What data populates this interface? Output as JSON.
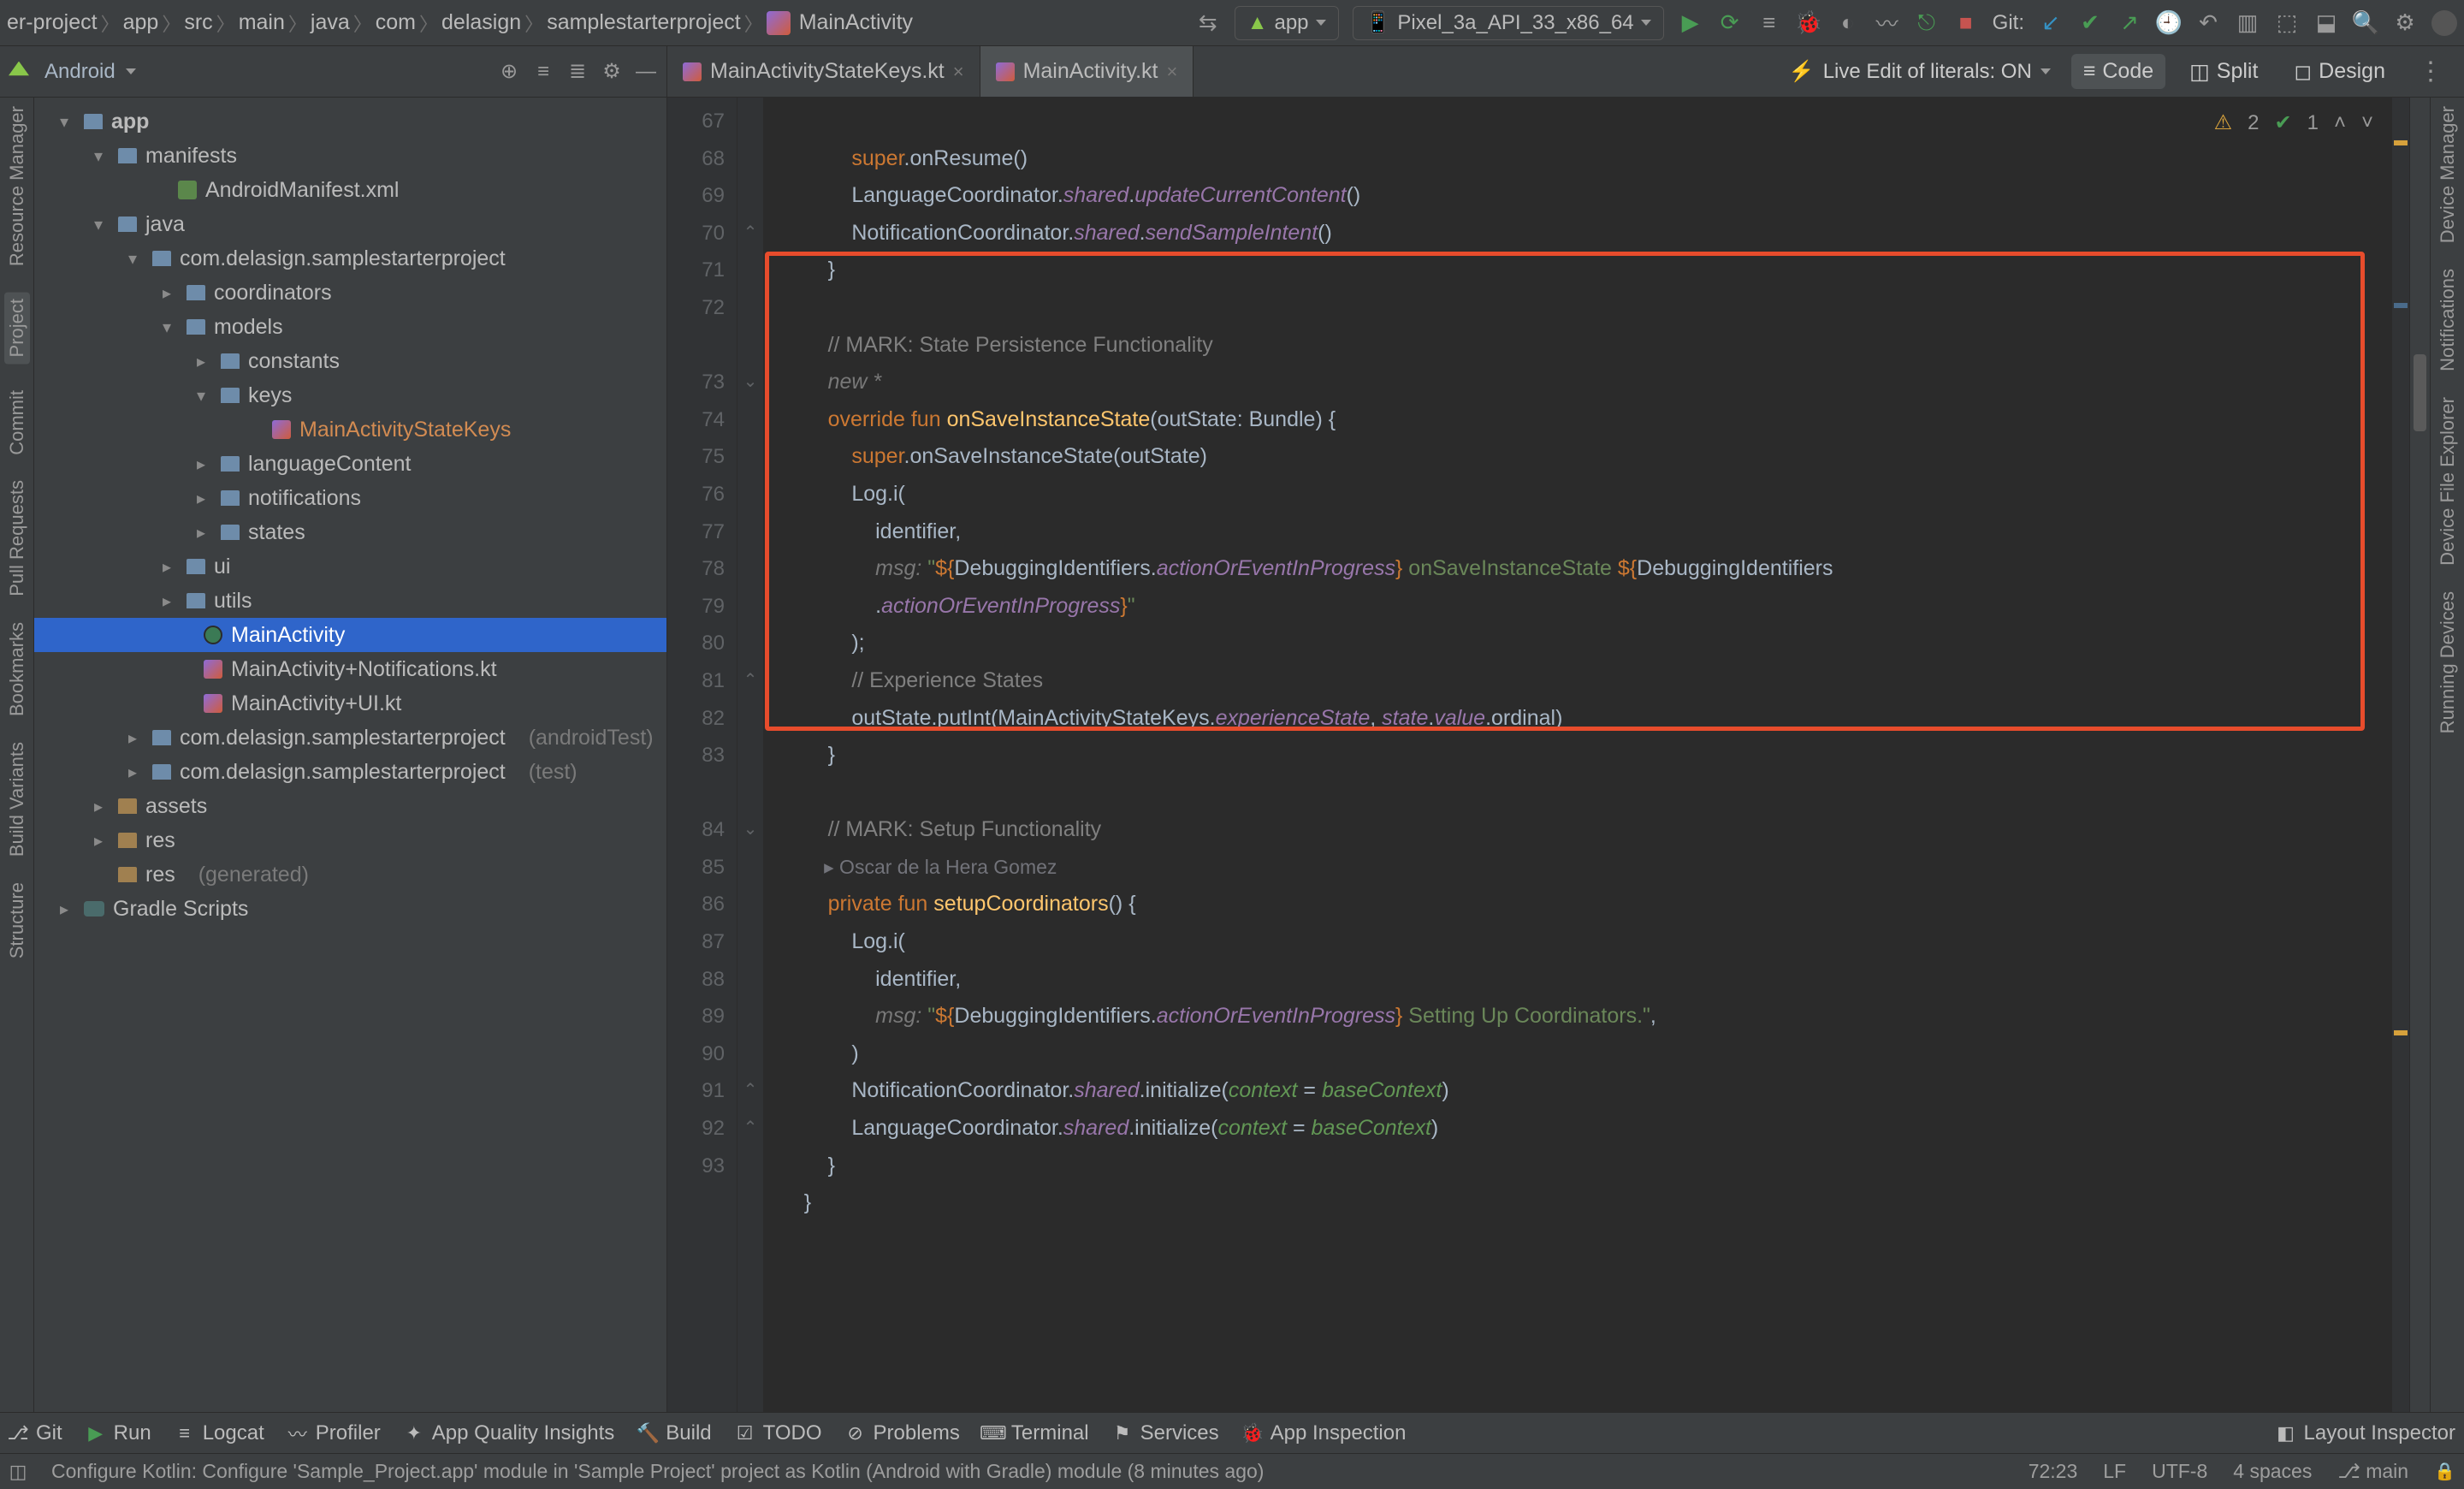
{
  "breadcrumbs": [
    "er-project",
    "app",
    "src",
    "main",
    "java",
    "com",
    "delasign",
    "samplestarterproject",
    "MainActivity"
  ],
  "toolbar": {
    "run_config": "app",
    "device": "Pixel_3a_API_33_x86_64",
    "git_label": "Git:"
  },
  "project_selector": "Android",
  "tabs": [
    {
      "label": "MainActivityStateKeys.kt",
      "active": false
    },
    {
      "label": "MainActivity.kt",
      "active": true
    }
  ],
  "live_edit": "Live Edit of literals: ON",
  "view_modes": {
    "code": "Code",
    "split": "Split",
    "design": "Design"
  },
  "editor_overlay": {
    "warn": "2",
    "ok": "1"
  },
  "left_rail": [
    "Resource Manager",
    "Project",
    "Commit",
    "Pull Requests",
    "Bookmarks",
    "Build Variants",
    "Structure"
  ],
  "right_rail": [
    "Device Manager",
    "Notifications",
    "Device File Explorer",
    "Running Devices"
  ],
  "tree": {
    "root": "app",
    "manifests": "manifests",
    "android_manifest": "AndroidManifest.xml",
    "java": "java",
    "pkg": "com.delasign.samplestarterproject",
    "coordinators": "coordinators",
    "models": "models",
    "constants": "constants",
    "keys": "keys",
    "state_keys": "MainActivityStateKeys",
    "languageContent": "languageContent",
    "notifications": "notifications",
    "states": "states",
    "ui": "ui",
    "utils": "utils",
    "main_activity": "MainActivity",
    "ma_notif": "MainActivity+Notifications.kt",
    "ma_ui": "MainActivity+UI.kt",
    "pkg_android_test": "com.delasign.samplestarterproject",
    "pkg_android_test_suffix": "(androidTest)",
    "pkg_test": "com.delasign.samplestarterproject",
    "pkg_test_suffix": "(test)",
    "assets": "assets",
    "res": "res",
    "res_gen": "res",
    "res_gen_suffix": "(generated)",
    "gradle": "Gradle Scripts"
  },
  "gutter": {
    "start": 67,
    "end": 93
  },
  "code": {
    "l67": "            super.onResume()",
    "l68_a": "            LanguageCoordinator.",
    "l68_b": "shared",
    "l68_c": ".",
    "l68_d": "updateCurrentContent",
    "l68_e": "()",
    "l69_a": "            NotificationCoordinator.",
    "l69_b": "shared",
    "l69_c": ".",
    "l69_d": "sendSampleIntent",
    "l69_e": "()",
    "l70": "        }",
    "l71": "",
    "l72": "        // MARK: State Persistence Functionality",
    "l72_inlay": "        new *",
    "l73_a": "        override fun ",
    "l73_b": "onSaveInstanceState",
    "l73_c": "(outState: Bundle) {",
    "l74": "            super.onSaveInstanceState(outState)",
    "l75": "            Log.i(",
    "l76": "                identifier,",
    "l77_a": "                ",
    "l77_msg": "msg: ",
    "l77_b": "\"",
    "l77_c": "${",
    "l77_d": "DebuggingIdentifiers.",
    "l77_e": "actionOrEventInProgress",
    "l77_f": "}",
    "l77_g": " onSaveInstanceState ",
    "l77_h": "${",
    "l77_i": "DebuggingIdentifiers",
    "l77b_a": "                .",
    "l77b_b": "actionOrEventInProgress",
    "l77b_c": "}",
    "l77b_d": "\"",
    "l78": "            );",
    "l79": "            // Experience States",
    "l80_a": "            outState.putInt(MainActivityStateKeys.",
    "l80_b": "experienceState",
    "l80_c": ", ",
    "l80_d": "state",
    "l80_e": ".",
    "l80_f": "value",
    "l80_g": ".ordinal)",
    "l81": "        }",
    "l82": "",
    "l83": "        // MARK: Setup Functionality",
    "l83_author": "        ▸ Oscar de la Hera Gomez",
    "l84_a": "        private fun ",
    "l84_b": "setupCoordinators",
    "l84_c": "() {",
    "l85": "            Log.i(",
    "l86": "                identifier,",
    "l87_a": "                ",
    "l87_msg": "msg: ",
    "l87_b": "\"",
    "l87_c": "${",
    "l87_d": "DebuggingIdentifiers.",
    "l87_e": "actionOrEventInProgress",
    "l87_f": "}",
    "l87_g": " Setting Up Coordinators.\"",
    "l87_h": ",",
    "l88": "            )",
    "l89_a": "            NotificationCoordinator.",
    "l89_b": "shared",
    "l89_c": ".initialize(",
    "l89_d": "context",
    "l89_e": " = ",
    "l89_f": "baseContext",
    "l89_g": ")",
    "l90_a": "            LanguageCoordinator.",
    "l90_b": "shared",
    "l90_c": ".initialize(",
    "l90_d": "context",
    "l90_e": " = ",
    "l90_f": "baseContext",
    "l90_g": ")",
    "l91": "        }",
    "l92": "    }",
    "l93": ""
  },
  "bottom": {
    "git": "Git",
    "run": "Run",
    "logcat": "Logcat",
    "profiler": "Profiler",
    "aqi": "App Quality Insights",
    "build": "Build",
    "todo": "TODO",
    "problems": "Problems",
    "terminal": "Terminal",
    "services": "Services",
    "inspection": "App Inspection",
    "layout": "Layout Inspector"
  },
  "status": {
    "msg": "Configure Kotlin: Configure 'Sample_Project.app' module in 'Sample Project' project as Kotlin (Android with Gradle) module (8 minutes ago)",
    "pos": "72:23",
    "lf": "LF",
    "enc": "UTF-8",
    "indent": "4 spaces",
    "branch": "main"
  }
}
